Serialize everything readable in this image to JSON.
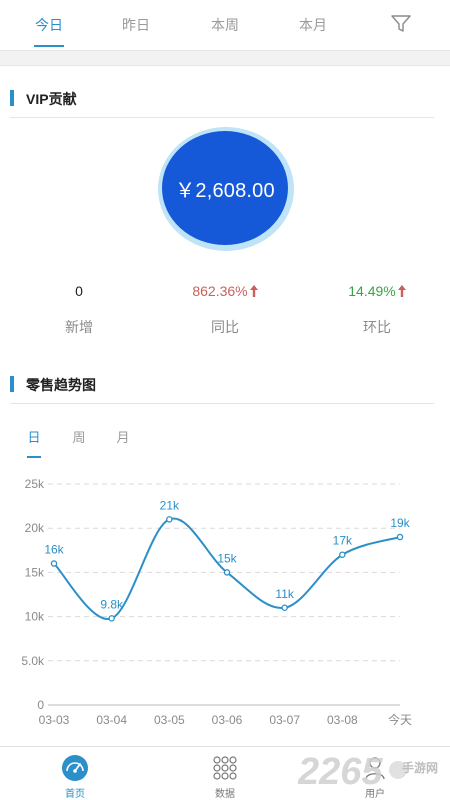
{
  "period_tabs": [
    {
      "label": "今日",
      "active": true
    },
    {
      "label": "昨日",
      "active": false
    },
    {
      "label": "本周",
      "active": false
    },
    {
      "label": "本月",
      "active": false
    }
  ],
  "vip_section": {
    "title": "VIP贡献",
    "amount": "￥2,608.00",
    "stats": [
      {
        "value": "0",
        "label": "新增",
        "trend": "none",
        "color": "#222222"
      },
      {
        "value": "862.36%",
        "label": "同比",
        "trend": "up",
        "color": "#c9605a"
      },
      {
        "value": "14.49%",
        "label": "环比",
        "trend": "up",
        "color": "#3aa341"
      }
    ]
  },
  "sales_section": {
    "title": "零售趋势图",
    "tabs": [
      {
        "label": "日",
        "active": true
      },
      {
        "label": "周",
        "active": false
      },
      {
        "label": "月",
        "active": false
      }
    ]
  },
  "chart_data": {
    "type": "line",
    "categories": [
      "03-03",
      "03-04",
      "03-05",
      "03-06",
      "03-07",
      "03-08",
      "今天"
    ],
    "values": [
      16000,
      9800,
      21000,
      15000,
      11000,
      17000,
      19000
    ],
    "data_labels": [
      "16k",
      "9.8k",
      "21k",
      "15k",
      "11k",
      "17k",
      "19k"
    ],
    "y_ticks": [
      0,
      5000,
      10000,
      15000,
      20000,
      25000
    ],
    "y_tick_labels": [
      "0",
      "5.0k",
      "10k",
      "15k",
      "20k",
      "25k"
    ],
    "ylim": [
      0,
      25000
    ],
    "grid": true,
    "smooth": true,
    "line_color": "#2b8fc9"
  },
  "bottom_nav": [
    {
      "label": "首页",
      "icon": "speedometer-icon",
      "active": true
    },
    {
      "label": "数据",
      "icon": "grid-dots-icon",
      "active": false
    },
    {
      "label": "用户",
      "icon": "user-icon",
      "active": false
    }
  ],
  "watermark": {
    "text": "2265",
    "sub": "手游网"
  },
  "colors": {
    "accent": "#2b8fc9",
    "vip_circle": "#1659d8",
    "vip_ring": "#bfe3f7"
  }
}
